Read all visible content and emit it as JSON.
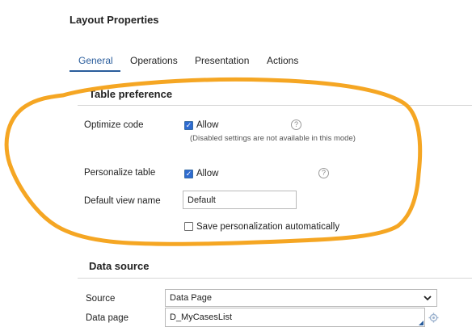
{
  "page": {
    "title": "Layout Properties"
  },
  "tabs": [
    {
      "label": "General",
      "active": true
    },
    {
      "label": "Operations",
      "active": false
    },
    {
      "label": "Presentation",
      "active": false
    },
    {
      "label": "Actions",
      "active": false
    }
  ],
  "table_preference": {
    "title": "Table preference",
    "optimize_code": {
      "label": "Optimize code",
      "checkbox_label": "Allow",
      "checked": true,
      "hint": "(Disabled settings are not available in this mode)",
      "help_icon": "?"
    },
    "personalize_table": {
      "label": "Personalize table",
      "checkbox_label": "Allow",
      "checked": true,
      "help_icon": "?"
    },
    "default_view_name": {
      "label": "Default view name",
      "value": "Default"
    },
    "save_personalization": {
      "checkbox_label": "Save personalization automatically",
      "checked": false
    }
  },
  "data_source": {
    "title": "Data source",
    "source": {
      "label": "Source",
      "value": "Data Page"
    },
    "data_page": {
      "label": "Data page",
      "value": "D_MyCasesList"
    }
  },
  "annotation": {
    "color": "#f5a623",
    "shape": "hand-drawn-circle"
  },
  "colors": {
    "accent": "#2a5d9c",
    "checkbox": "#2e6bd0"
  },
  "icons": {
    "help": "help-icon",
    "select": "chevron-down-icon",
    "gear": "gear-icon"
  }
}
